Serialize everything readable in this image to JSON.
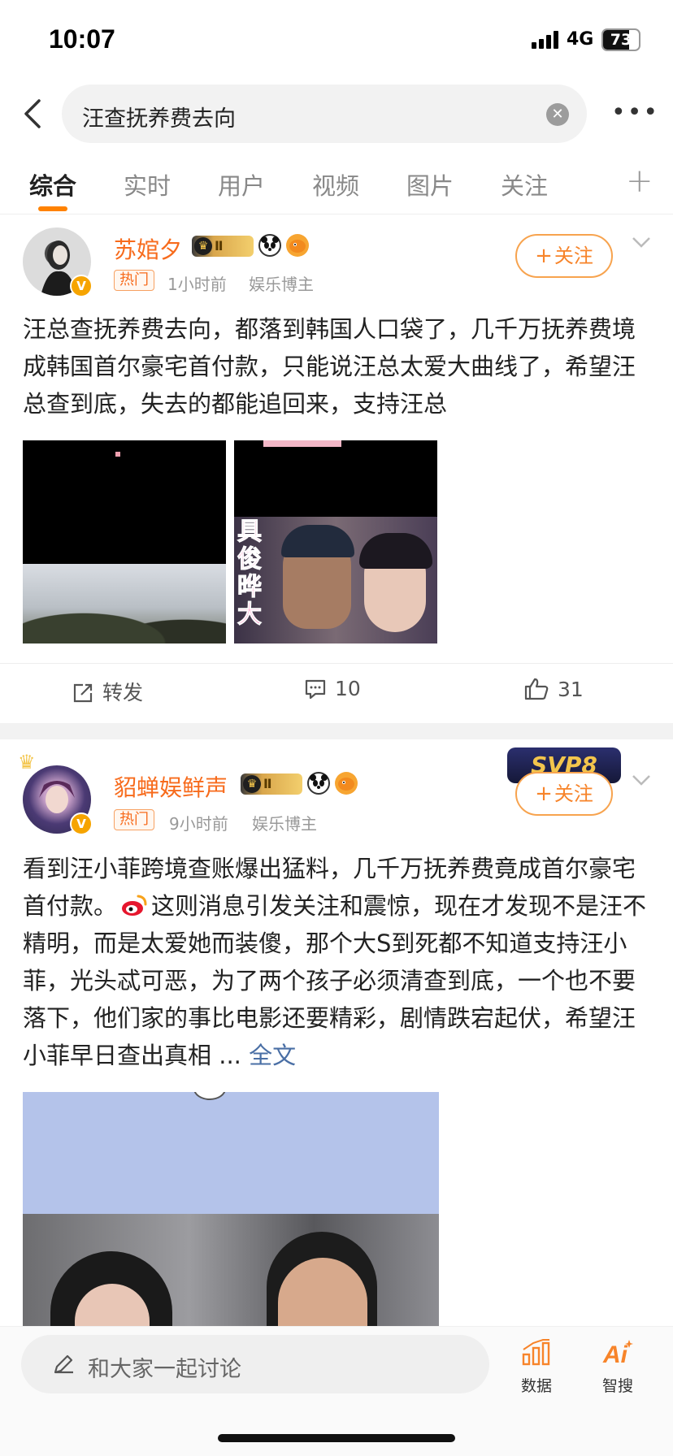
{
  "status_bar": {
    "time": "10:07",
    "network": "4G",
    "battery": "73",
    "battery_level": 0.73
  },
  "search": {
    "query": "汪查抚养费去向"
  },
  "tabs": [
    {
      "label": "综合"
    },
    {
      "label": "实时"
    },
    {
      "label": "用户"
    },
    {
      "label": "视频"
    },
    {
      "label": "图片"
    },
    {
      "label": "关注"
    }
  ],
  "posts": [
    {
      "username": "苏婠夕",
      "rank": "Ⅱ",
      "tag": "热门",
      "time": "1小时前",
      "category": "娱乐博主",
      "follow_label": "关注",
      "text": "汪总查抚养费去向，都落到韩国人口袋了，几千万抚养费境成韩国首尔豪宅首付款，只能说汪总太爱大曲线了，希望汪总查到底，失去的都能追回来，支持汪总",
      "image_caption": "具俊晔大",
      "actions": {
        "repost": "转发",
        "comments": "10",
        "likes": "31"
      }
    },
    {
      "username": "貂蝉娱鲜声",
      "rank": "Ⅱ",
      "tag": "热门",
      "time": "9小时前",
      "category": "娱乐博主",
      "follow_label": "关注",
      "text_before_icon": "看到汪小菲跨境查账爆出猛料，几千万抚养费竟成首尔豪宅首付款。",
      "text_after_icon": "这则消息引发关注和震惊，现在才发现不是汪不精明，而是太爱她而装傻，那个大S到死都不知道支持汪小菲，光头忒可恶，为了两个孩子必须清查到底，一个也不要落下，他们家的事比电影还要精彩，剧情跌宕起伏，希望汪小菲早日查出真相",
      "ellipsis": " ... ",
      "full_text_link": "全文",
      "badge_text": "SVP8"
    }
  ],
  "bottom_bar": {
    "placeholder": "和大家一起讨论",
    "data_label": "数据",
    "ai_label": "智搜"
  },
  "colors": {
    "accent": "#ff8200",
    "username": "#f76b1c",
    "link": "#4a6fa5"
  }
}
